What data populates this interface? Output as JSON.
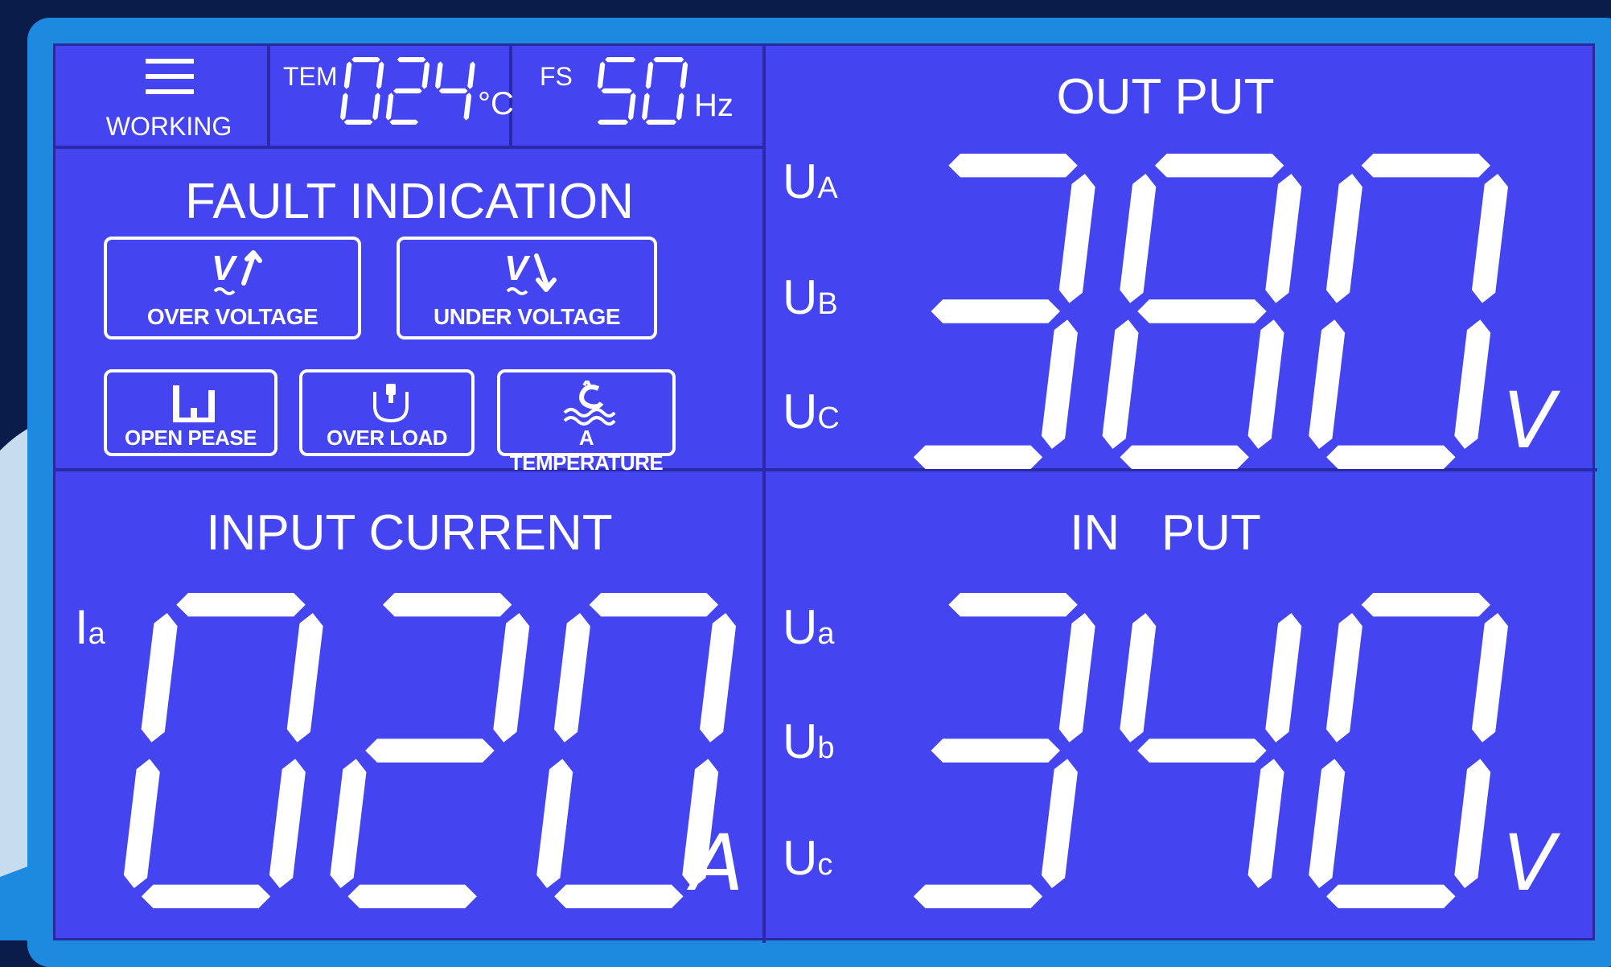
{
  "status": {
    "label": "WORKING",
    "icon": "menu-lines-icon"
  },
  "temperature": {
    "label": "TEM",
    "value": "024",
    "unit": "°C"
  },
  "frequency": {
    "label": "FS",
    "value": "50",
    "unit": "Hz"
  },
  "fault": {
    "title": "FAULT INDICATION",
    "items": [
      {
        "label": "OVER VOLTAGE",
        "icon": "voltage-up-icon",
        "glyph": "V"
      },
      {
        "label": "UNDER VOLTAGE",
        "icon": "voltage-down-icon",
        "glyph": "V"
      },
      {
        "label": "OPEN PEASE",
        "icon": "phase-bars-icon"
      },
      {
        "label": "OVER LOAD",
        "icon": "plug-icon"
      },
      {
        "label": "A TEMPERATURE",
        "icon": "temperature-water-icon"
      }
    ]
  },
  "output": {
    "title": "OUT PUT",
    "phases": [
      {
        "main": "U",
        "sub": "A"
      },
      {
        "main": "U",
        "sub": "B"
      },
      {
        "main": "U",
        "sub": "C"
      }
    ],
    "value": "380",
    "unit": "V"
  },
  "current": {
    "title": "INPUT CURRENT",
    "phase": {
      "main": "I",
      "sub": "a"
    },
    "value": "020",
    "unit": "A"
  },
  "input": {
    "title": "IN   PUT",
    "phases": [
      {
        "main": "U",
        "sub": "a"
      },
      {
        "main": "U",
        "sub": "b"
      },
      {
        "main": "U",
        "sub": "c"
      }
    ],
    "value": "340",
    "unit": "V"
  },
  "colors": {
    "screen": "#4444f0",
    "frame": "#1d8ae0",
    "background": "#0a1d4a",
    "segment": "#ffffff"
  }
}
